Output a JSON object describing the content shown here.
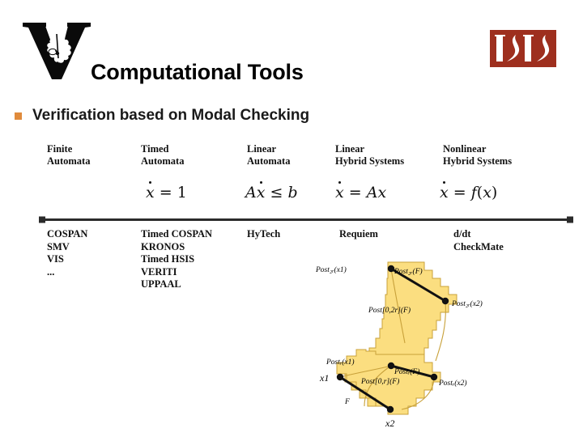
{
  "slide": {
    "title": "Computational Tools",
    "bullet": {
      "marker_color": "#E08B3C",
      "text": "Verification based on Modal Checking"
    }
  },
  "logos": {
    "vanderbilt": "vanderbilt-v-logo",
    "isis": {
      "name": "isis-logo",
      "text": "ISIS",
      "background": "#9E2F1E",
      "foreground": "#FFFFFF"
    }
  },
  "table": {
    "columns": [
      {
        "header_line1": "Finite",
        "header_line2": "Automata",
        "equation": "",
        "tools": [
          "COSPAN",
          "SMV",
          "VIS",
          "..."
        ]
      },
      {
        "header_line1": "Timed",
        "header_line2": "Automata",
        "equation": "ẋ = 1",
        "tools": [
          "Timed COSPAN",
          "KRONOS",
          "Timed HSIS",
          "VERITI",
          "UPPAAL"
        ]
      },
      {
        "header_line1": "Linear",
        "header_line2": "Automata",
        "equation": "Aẋ ≤ b",
        "tools": [
          "HyTech"
        ]
      },
      {
        "header_line1": "Linear",
        "header_line2": "Hybrid Systems",
        "equation": "ẋ = Ax",
        "tools": [
          "Requiem"
        ]
      },
      {
        "header_line1": "Nonlinear",
        "header_line2": "Hybrid Systems",
        "equation": "ẋ = f(x)",
        "tools": [
          "d/dt",
          "CheckMate"
        ]
      }
    ]
  },
  "diagram": {
    "name": "reachability-post-diagram",
    "fill_color": "#FBDE80",
    "stroke_color": "#C8A13A",
    "accent_color": "#000000",
    "labels": {
      "post_2r_x1": "Post₂ᵣ(x1)",
      "post_2r_F": "Post₂ᵣ(F)",
      "post_2r_x2": "Post₂ᵣ(x2)",
      "post_0_2r_F": "Post[0,2r](F)",
      "post_r_x1": "Postᵣ(x1)",
      "post_r_F": "Postᵣ(F)",
      "post_r_x2": "Postᵣ(x2)",
      "post_0_r_F": "Post[0,r](F)",
      "axis_x1": "x1",
      "axis_x2": "x2",
      "region_F": "F"
    }
  }
}
